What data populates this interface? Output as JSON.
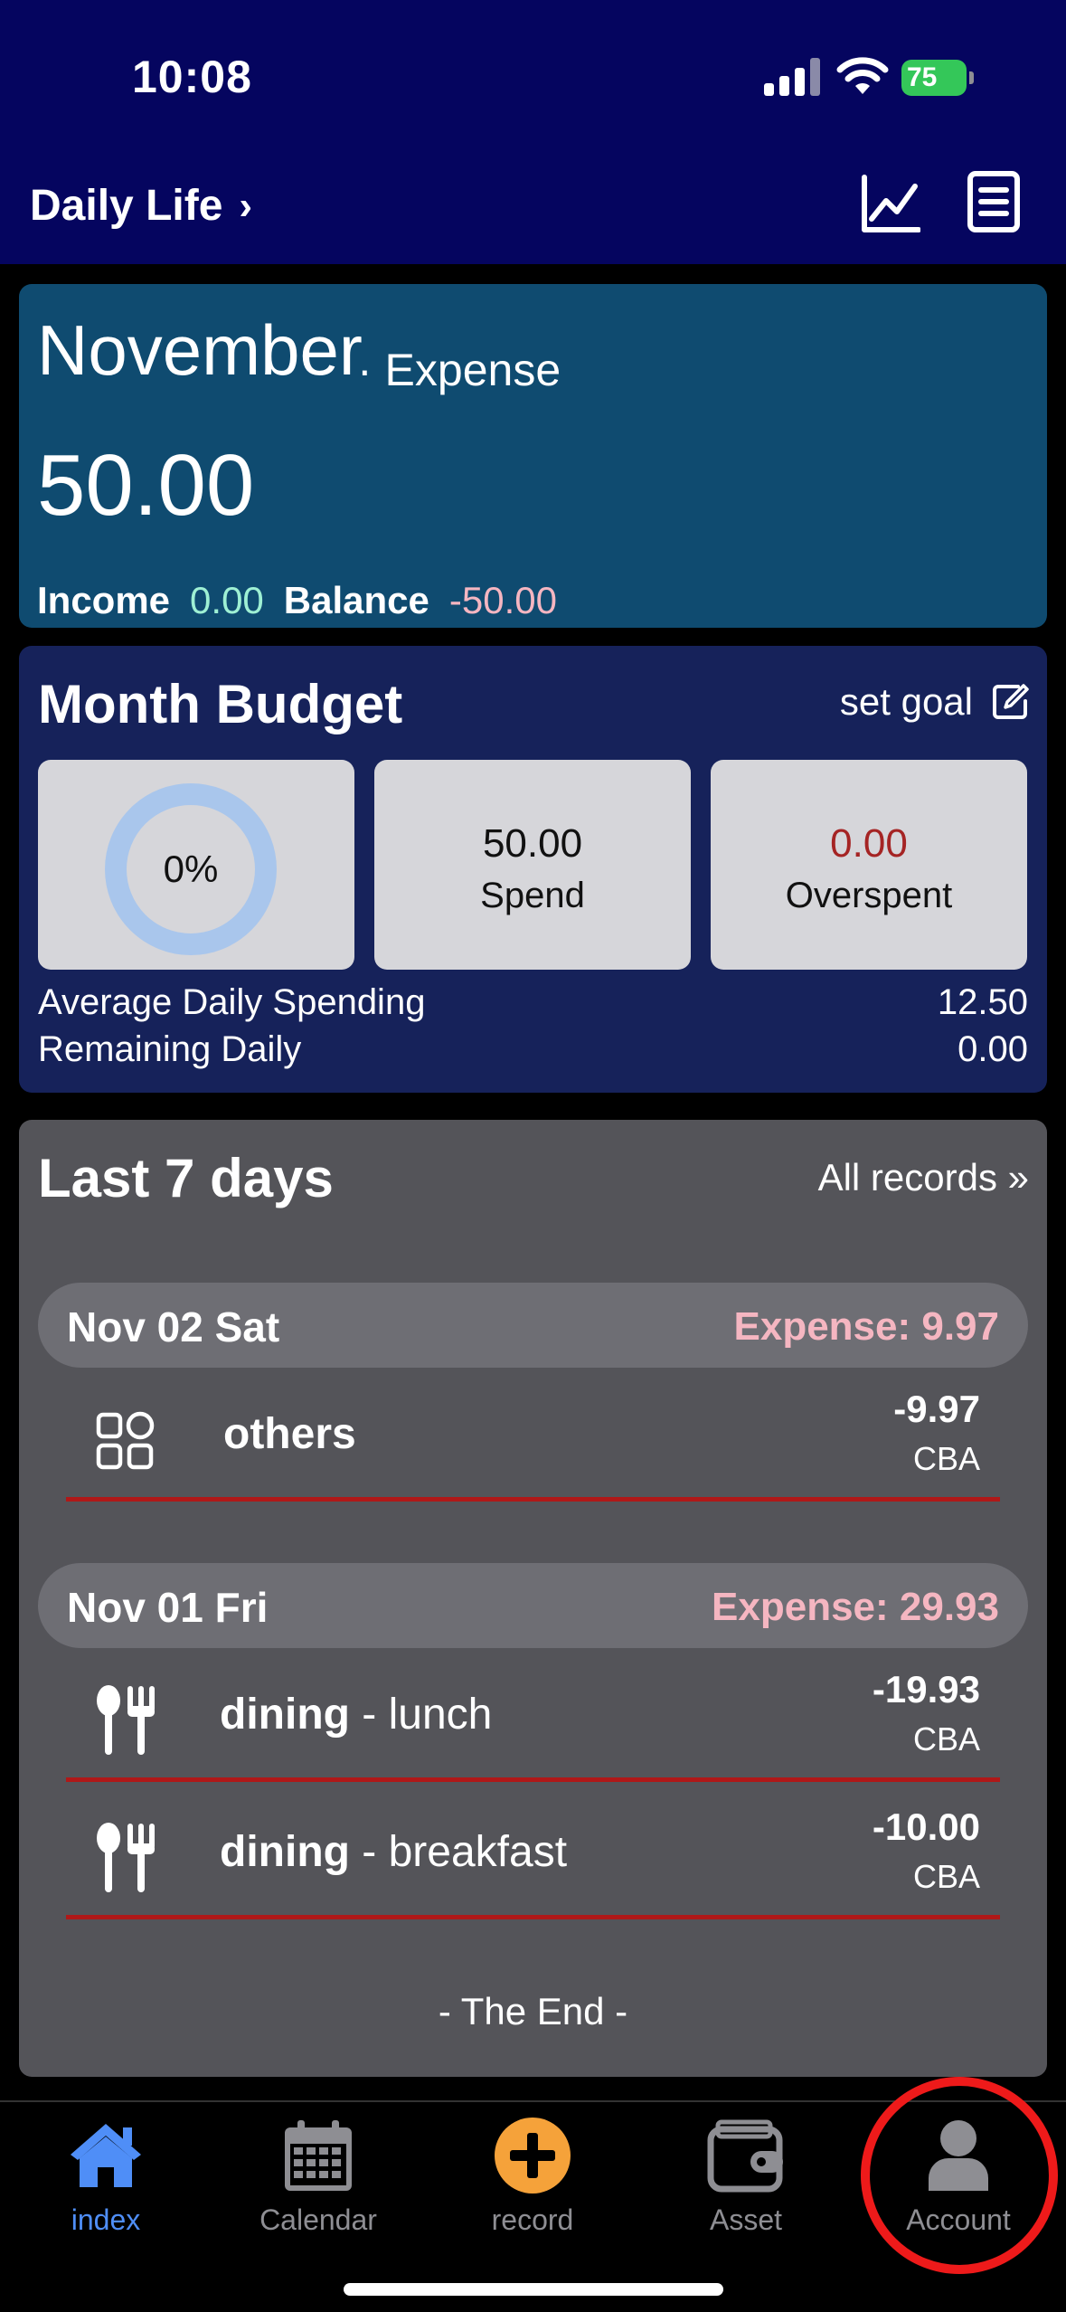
{
  "status": {
    "time": "10:08",
    "battery": "75"
  },
  "nav": {
    "title": "Daily Life",
    "chevron": "›",
    "chart_icon": "line-chart-icon",
    "list_icon": "document-icon"
  },
  "summary": {
    "month": "November",
    "type": "· Expense",
    "amount": "50.00",
    "income_label": "Income",
    "income_value": "0.00",
    "balance_label": "Balance",
    "balance_value": "-50.00"
  },
  "budget": {
    "title": "Month Budget",
    "set_goal": "set goal",
    "progress_text": "0%",
    "progress_fraction": 0,
    "spend_value": "50.00",
    "spend_label": "Spend",
    "overspent_value": "0.00",
    "overspent_label": "Overspent",
    "avg_label": "Average Daily Spending",
    "avg_value": "12.50",
    "remaining_label": "Remaining Daily",
    "remaining_value": "0.00"
  },
  "records": {
    "title": "Last 7 days",
    "all_records": "All records »",
    "days": [
      {
        "date": "Nov 02 Sat",
        "expense": "Expense: 9.97",
        "items": [
          {
            "icon": "grid-icon",
            "category": "others",
            "note": "",
            "amount": "-9.97",
            "account": "CBA"
          }
        ]
      },
      {
        "date": "Nov 01 Fri",
        "expense": "Expense: 29.93",
        "items": [
          {
            "icon": "cutlery-icon",
            "category": "dining",
            "note": " - lunch",
            "amount": "-19.93",
            "account": "CBA"
          },
          {
            "icon": "cutlery-icon",
            "category": "dining",
            "note": " - breakfast",
            "amount": "-10.00",
            "account": "CBA"
          }
        ]
      }
    ],
    "end_text": "- The End -"
  },
  "tabs": [
    {
      "label": "index",
      "icon": "home-icon",
      "active": true
    },
    {
      "label": "Calendar",
      "icon": "calendar-icon",
      "active": false
    },
    {
      "label": "record",
      "icon": "plus-circle-icon",
      "active": false
    },
    {
      "label": "Asset",
      "icon": "wallet-icon",
      "active": false
    },
    {
      "label": "Account",
      "icon": "person-icon",
      "active": false
    }
  ],
  "colors": {
    "header": "#05055f",
    "summary": "#0f4b70",
    "budget": "#16225a",
    "records": "#545459",
    "accent": "#4f8ef7",
    "annotation": "#ee1a1a"
  }
}
